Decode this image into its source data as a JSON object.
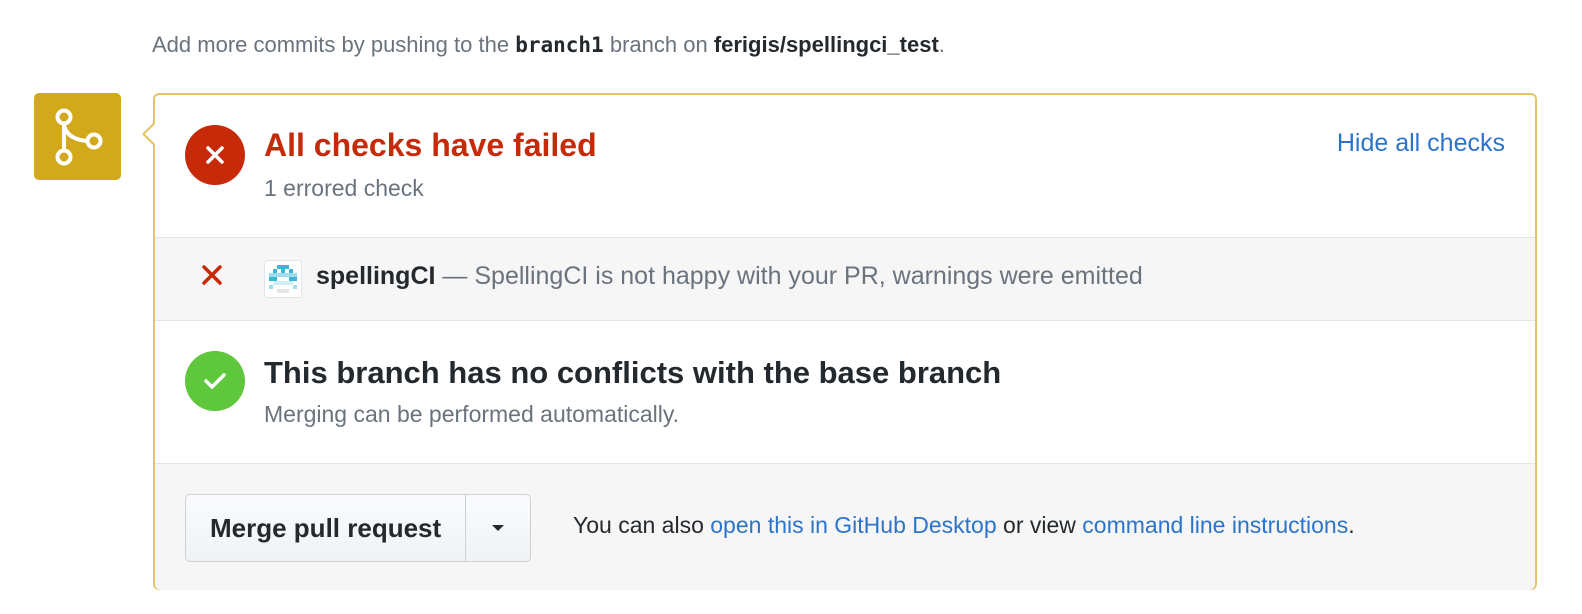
{
  "hint": {
    "prefix": "Add more commits by pushing to the",
    "branch": "branch1",
    "middle": "branch on",
    "repo": "ferigis/spellingci_test",
    "suffix": "."
  },
  "checks": {
    "title": "All checks have failed",
    "subtitle": "1 errored check",
    "hide_link": "Hide all checks",
    "items": [
      {
        "app_name": "spellingCI",
        "separator": "—",
        "description": "SpellingCI is not happy with your PR, warnings were emitted",
        "status_icon": "x-icon"
      }
    ]
  },
  "conflicts": {
    "title": "This branch has no conflicts with the base branch",
    "subtitle": "Merging can be performed automatically."
  },
  "merge": {
    "button_label": "Merge pull request",
    "alt_prefix": "You can also",
    "desktop_link": "open this in GitHub Desktop",
    "alt_middle": "or view",
    "cli_link": "command line instructions",
    "alt_suffix": "."
  },
  "colors": {
    "fail": "#c62a08",
    "success": "#5fc73b",
    "merge_icon_bg": "#d3a91c",
    "link": "#2c74c9",
    "panel_border": "#e5c36a"
  }
}
